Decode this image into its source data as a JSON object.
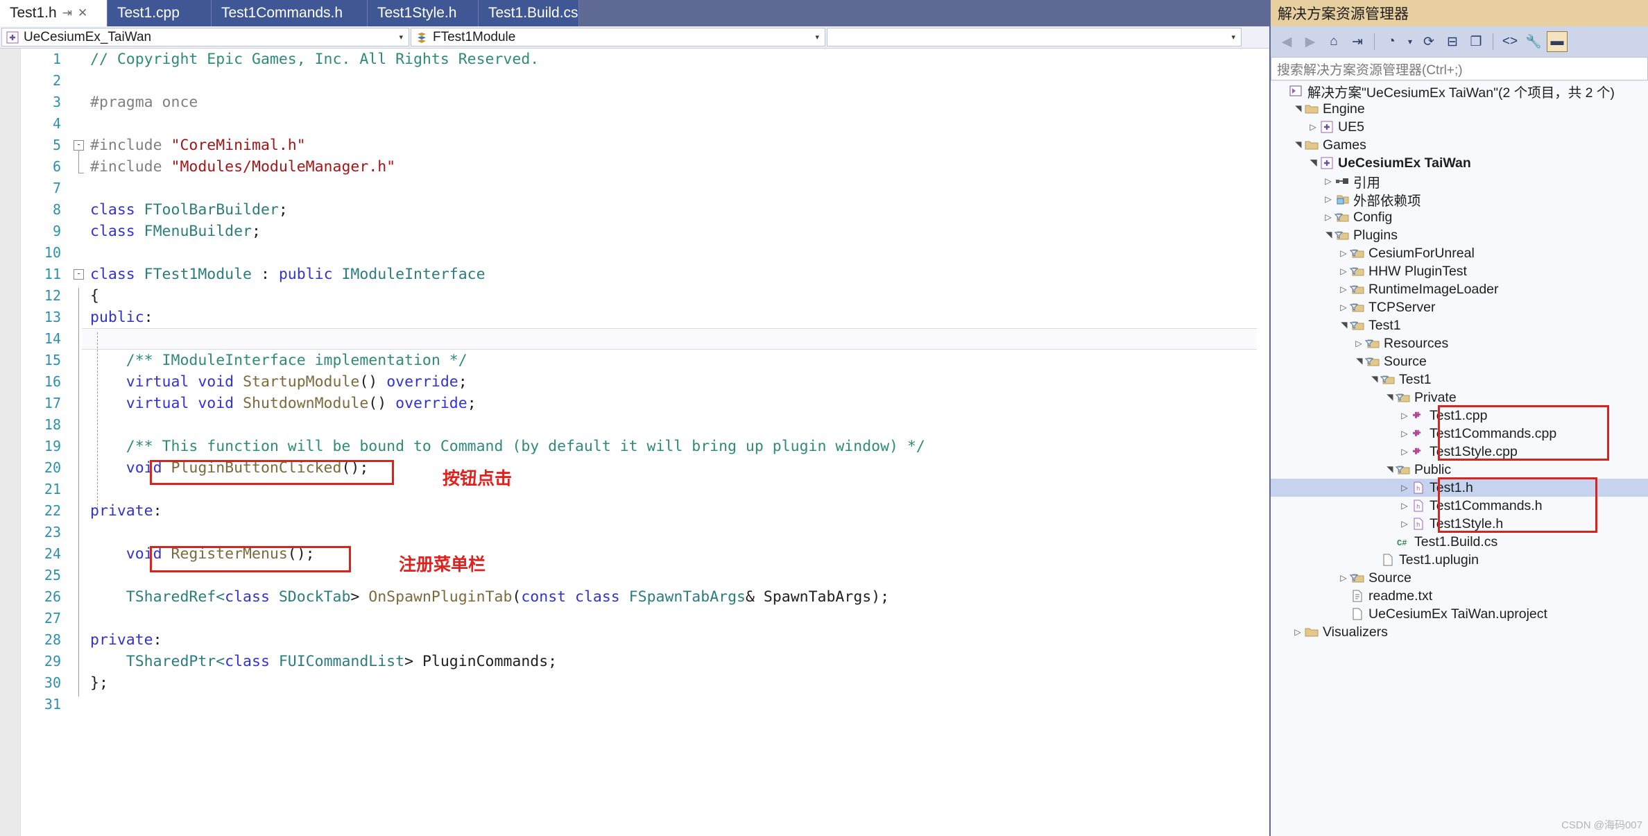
{
  "tabs": [
    {
      "label": "Test1.h",
      "active": true,
      "pin": "📌",
      "close": "✕"
    },
    {
      "label": "Test1.cpp",
      "active": false
    },
    {
      "label": "Test1Commands.h",
      "active": false
    },
    {
      "label": "Test1Style.h",
      "active": false
    },
    {
      "label": "Test1.Build.cs",
      "active": false
    }
  ],
  "tabstrip": {
    "overflow_caret": "▾",
    "settings_icon": "⚙"
  },
  "navbar": {
    "class_scope": "UeCesiumEx_TaiWan",
    "member_scope": "FTest1Module",
    "blank_scope": "",
    "caret": "▾",
    "split_icon": "⊹"
  },
  "editor": {
    "lines": [
      {
        "n": "1",
        "tokens": [
          {
            "t": "// Copyright Epic Games, Inc. All Rights Reserved.",
            "c": "c-cmt"
          }
        ],
        "indent": 0
      },
      {
        "n": "2",
        "tokens": []
      },
      {
        "n": "3",
        "tokens": [
          {
            "t": "#pragma once",
            "c": "c-pre"
          }
        ]
      },
      {
        "n": "4",
        "tokens": []
      },
      {
        "n": "5",
        "tokens": [
          {
            "t": "#include ",
            "c": "c-pre"
          },
          {
            "t": "\"CoreMinimal.h\"",
            "c": "c-str"
          }
        ],
        "fold": "-"
      },
      {
        "n": "6",
        "tokens": [
          {
            "t": "#include ",
            "c": "c-pre"
          },
          {
            "t": "\"Modules/ModuleManager.h\"",
            "c": "c-str"
          }
        ]
      },
      {
        "n": "7",
        "tokens": []
      },
      {
        "n": "8",
        "tokens": [
          {
            "t": "class ",
            "c": "c-kw"
          },
          {
            "t": "FToolBarBuilder",
            "c": "c-typ"
          },
          {
            "t": ";",
            "c": "c-pl"
          }
        ]
      },
      {
        "n": "9",
        "tokens": [
          {
            "t": "class ",
            "c": "c-kw"
          },
          {
            "t": "FMenuBuilder",
            "c": "c-typ"
          },
          {
            "t": ";",
            "c": "c-pl"
          }
        ]
      },
      {
        "n": "10",
        "tokens": []
      },
      {
        "n": "11",
        "tokens": [
          {
            "t": "class ",
            "c": "c-kw"
          },
          {
            "t": "FTest1Module",
            "c": "c-typ"
          },
          {
            "t": " : ",
            "c": "c-pl"
          },
          {
            "t": "public ",
            "c": "c-kw"
          },
          {
            "t": "IModuleInterface",
            "c": "c-typ"
          }
        ],
        "fold": "-"
      },
      {
        "n": "12",
        "tokens": [
          {
            "t": "{",
            "c": "c-pl"
          }
        ]
      },
      {
        "n": "13",
        "tokens": [
          {
            "t": "public",
            "c": "c-kw"
          },
          {
            "t": ":",
            "c": "c-pl"
          }
        ]
      },
      {
        "n": "14",
        "tokens": [],
        "cursor": true
      },
      {
        "n": "15",
        "tokens": [
          {
            "t": "    /** IModuleInterface implementation */",
            "c": "c-cmt"
          }
        ]
      },
      {
        "n": "16",
        "tokens": [
          {
            "t": "    virtual void ",
            "c": "c-kw"
          },
          {
            "t": "StartupModule",
            "c": "c-fn"
          },
          {
            "t": "() ",
            "c": "c-pl"
          },
          {
            "t": "override",
            "c": "c-kw"
          },
          {
            "t": ";",
            "c": "c-pl"
          }
        ]
      },
      {
        "n": "17",
        "tokens": [
          {
            "t": "    virtual void ",
            "c": "c-kw"
          },
          {
            "t": "ShutdownModule",
            "c": "c-fn"
          },
          {
            "t": "() ",
            "c": "c-pl"
          },
          {
            "t": "override",
            "c": "c-kw"
          },
          {
            "t": ";",
            "c": "c-pl"
          }
        ]
      },
      {
        "n": "18",
        "tokens": []
      },
      {
        "n": "19",
        "tokens": [
          {
            "t": "    /** This function will be bound to Command (by default it will bring up plugin window) */",
            "c": "c-cmt"
          }
        ]
      },
      {
        "n": "20",
        "tokens": [
          {
            "t": "    void ",
            "c": "c-kw"
          },
          {
            "t": "PluginButtonClicked",
            "c": "c-fn"
          },
          {
            "t": "();",
            "c": "c-pl"
          }
        ]
      },
      {
        "n": "21",
        "tokens": []
      },
      {
        "n": "22",
        "tokens": [
          {
            "t": "private",
            "c": "c-kw"
          },
          {
            "t": ":",
            "c": "c-pl"
          }
        ]
      },
      {
        "n": "23",
        "tokens": []
      },
      {
        "n": "24",
        "tokens": [
          {
            "t": "    void ",
            "c": "c-kw"
          },
          {
            "t": "RegisterMenus",
            "c": "c-fn"
          },
          {
            "t": "();",
            "c": "c-pl"
          }
        ]
      },
      {
        "n": "25",
        "tokens": []
      },
      {
        "n": "26",
        "tokens": [
          {
            "t": "    TSharedRef<",
            "c": "c-typ"
          },
          {
            "t": "class ",
            "c": "c-kw"
          },
          {
            "t": "SDockTab",
            "c": "c-typ"
          },
          {
            "t": "> ",
            "c": "c-pl"
          },
          {
            "t": "OnSpawnPluginTab",
            "c": "c-fn"
          },
          {
            "t": "(",
            "c": "c-pl"
          },
          {
            "t": "const class ",
            "c": "c-kw"
          },
          {
            "t": "FSpawnTabArgs",
            "c": "c-typ"
          },
          {
            "t": "& SpawnTabArgs);",
            "c": "c-pl"
          }
        ]
      },
      {
        "n": "27",
        "tokens": []
      },
      {
        "n": "28",
        "tokens": [
          {
            "t": "private",
            "c": "c-kw"
          },
          {
            "t": ":",
            "c": "c-pl"
          }
        ]
      },
      {
        "n": "29",
        "tokens": [
          {
            "t": "    TSharedPtr<",
            "c": "c-typ"
          },
          {
            "t": "class ",
            "c": "c-kw"
          },
          {
            "t": "FUICommandList",
            "c": "c-typ"
          },
          {
            "t": "> PluginCommands;",
            "c": "c-pl"
          }
        ]
      },
      {
        "n": "30",
        "tokens": [
          {
            "t": "};",
            "c": "c-pl"
          }
        ]
      },
      {
        "n": "31",
        "tokens": []
      }
    ],
    "annotations": [
      {
        "text": "按钮点击",
        "for": "PluginButtonClicked"
      },
      {
        "text": "注册菜单栏",
        "for": "RegisterMenus"
      }
    ],
    "scroll": {
      "up_arrow": "▲",
      "down_arrow": "▼"
    }
  },
  "solution_explorer": {
    "title": "解决方案资源管理器",
    "search_placeholder": "搜索解决方案资源管理器(Ctrl+;)",
    "toolbar": [
      {
        "name": "back-icon",
        "glyph": "◀",
        "dim": true
      },
      {
        "name": "forward-icon",
        "glyph": "▶",
        "dim": true
      },
      {
        "name": "home-icon",
        "glyph": "⌂",
        "dim": false
      },
      {
        "name": "sync-with-active-document-icon",
        "glyph": "⇥",
        "dim": false
      },
      {
        "name": "pending-changes-filter-icon",
        "glyph": "◔",
        "dim": false
      },
      {
        "name": "filter-dropdown-caret-icon",
        "glyph": "▾",
        "dim": false
      },
      {
        "name": "refresh-icon",
        "glyph": "⟳",
        "dim": false
      },
      {
        "name": "collapse-all-icon",
        "glyph": "⊟",
        "dim": false
      },
      {
        "name": "show-all-files-icon",
        "glyph": "❐",
        "dim": false
      },
      {
        "name": "code-view-icon",
        "glyph": "<>",
        "dim": false
      },
      {
        "name": "properties-wrench-icon",
        "glyph": "🔧",
        "dim": false
      },
      {
        "name": "preview-selected-items-icon",
        "glyph": "▬",
        "dim": false,
        "selected": true
      }
    ],
    "tree": [
      {
        "depth": 0,
        "label": "解决方案\"UeCesiumEx TaiWan\"(2 个项目，共 2 个)",
        "icon": "solution",
        "exp": "",
        "bold": false
      },
      {
        "depth": 1,
        "label": "Engine",
        "icon": "folder",
        "exp": "▲",
        "bold": false
      },
      {
        "depth": 2,
        "label": "UE5",
        "icon": "project",
        "exp": "▷",
        "bold": false
      },
      {
        "depth": 1,
        "label": "Games",
        "icon": "folder",
        "exp": "▲",
        "bold": false
      },
      {
        "depth": 2,
        "label": "UeCesiumEx TaiWan",
        "icon": "project",
        "exp": "▲",
        "bold": true
      },
      {
        "depth": 3,
        "label": "引用",
        "icon": "refs",
        "exp": "▷",
        "bold": false
      },
      {
        "depth": 3,
        "label": "外部依赖项",
        "icon": "extdep",
        "exp": "▷",
        "bold": false
      },
      {
        "depth": 3,
        "label": "Config",
        "icon": "filterfolder",
        "exp": "▷",
        "bold": false
      },
      {
        "depth": 3,
        "label": "Plugins",
        "icon": "filterfolder",
        "exp": "▲",
        "bold": false
      },
      {
        "depth": 4,
        "label": "CesiumForUnreal",
        "icon": "filterfolder",
        "exp": "▷",
        "bold": false
      },
      {
        "depth": 4,
        "label": "HHW PluginTest",
        "icon": "filterfolder",
        "exp": "▷",
        "bold": false
      },
      {
        "depth": 4,
        "label": "RuntimeImageLoader",
        "icon": "filterfolder",
        "exp": "▷",
        "bold": false
      },
      {
        "depth": 4,
        "label": "TCPServer",
        "icon": "filterfolder",
        "exp": "▷",
        "bold": false
      },
      {
        "depth": 4,
        "label": "Test1",
        "icon": "filterfolder",
        "exp": "▲",
        "bold": false
      },
      {
        "depth": 5,
        "label": "Resources",
        "icon": "filterfolder",
        "exp": "▷",
        "bold": false
      },
      {
        "depth": 5,
        "label": "Source",
        "icon": "filterfolder",
        "exp": "▲",
        "bold": false
      },
      {
        "depth": 6,
        "label": "Test1",
        "icon": "filterfolder",
        "exp": "▲",
        "bold": false
      },
      {
        "depth": 7,
        "label": "Private",
        "icon": "filterfolder",
        "exp": "▲",
        "bold": false
      },
      {
        "depth": 8,
        "label": "Test1.cpp",
        "icon": "cpp",
        "exp": "▷",
        "bold": false
      },
      {
        "depth": 8,
        "label": "Test1Commands.cpp",
        "icon": "cpp",
        "exp": "▷",
        "bold": false
      },
      {
        "depth": 8,
        "label": "Test1Style.cpp",
        "icon": "cpp",
        "exp": "▷",
        "bold": false
      },
      {
        "depth": 7,
        "label": "Public",
        "icon": "filterfolder",
        "exp": "▲",
        "bold": false
      },
      {
        "depth": 8,
        "label": "Test1.h",
        "icon": "h",
        "exp": "▷",
        "bold": false,
        "selected": true
      },
      {
        "depth": 8,
        "label": "Test1Commands.h",
        "icon": "h",
        "exp": "▷",
        "bold": false
      },
      {
        "depth": 8,
        "label": "Test1Style.h",
        "icon": "h",
        "exp": "▷",
        "bold": false
      },
      {
        "depth": 7,
        "label": "Test1.Build.cs",
        "icon": "cs",
        "exp": "",
        "bold": false
      },
      {
        "depth": 6,
        "label": "Test1.uplugin",
        "icon": "file",
        "exp": "",
        "bold": false
      },
      {
        "depth": 4,
        "label": "Source",
        "icon": "filterfolder",
        "exp": "▷",
        "bold": false
      },
      {
        "depth": 4,
        "label": "readme.txt",
        "icon": "txt",
        "exp": "",
        "bold": false
      },
      {
        "depth": 4,
        "label": "UeCesiumEx TaiWan.uproject",
        "icon": "file",
        "exp": "",
        "bold": false
      },
      {
        "depth": 1,
        "label": "Visualizers",
        "icon": "folder",
        "exp": "▷",
        "bold": false
      }
    ]
  },
  "watermark": "CSDN @海码007"
}
